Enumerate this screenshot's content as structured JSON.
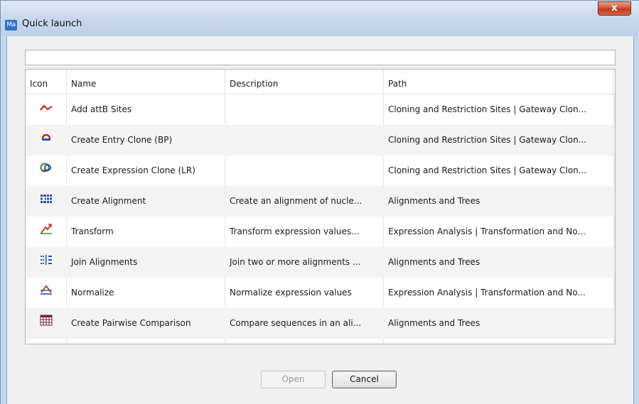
{
  "window": {
    "title": "Quick launch",
    "app_icon_text": "Ma",
    "close_glyph": "x"
  },
  "search": {
    "value": "",
    "placeholder": ""
  },
  "table": {
    "columns": [
      "Icon",
      "Name",
      "Description",
      "Path"
    ],
    "rows": [
      {
        "icon": "add-attb-sites-icon",
        "name": "Add attB Sites",
        "description": "",
        "path": "Cloning and Restriction Sites | Gateway Clon..."
      },
      {
        "icon": "create-entry-clone-icon",
        "name": "Create Entry Clone (BP)",
        "description": "",
        "path": "Cloning and Restriction Sites | Gateway Clon..."
      },
      {
        "icon": "create-expression-clone-icon",
        "name": "Create Expression Clone (LR)",
        "description": "",
        "path": "Cloning and Restriction Sites | Gateway Clon..."
      },
      {
        "icon": "create-alignment-icon",
        "name": "Create Alignment",
        "description": "Create an alignment of nucle...",
        "path": "Alignments and Trees"
      },
      {
        "icon": "transform-icon",
        "name": "Transform",
        "description": "Transform expression values...",
        "path": "Expression Analysis | Transformation and No..."
      },
      {
        "icon": "join-alignments-icon",
        "name": "Join Alignments",
        "description": "Join two or more alignments ...",
        "path": "Alignments and Trees"
      },
      {
        "icon": "normalize-icon",
        "name": "Normalize",
        "description": "Normalize expression values",
        "path": "Expression Analysis | Transformation and No..."
      },
      {
        "icon": "create-pairwise-comparison-icon",
        "name": "Create Pairwise Comparison",
        "description": "Compare sequences in an ali...",
        "path": "Alignments and Trees"
      }
    ]
  },
  "buttons": {
    "open": "Open",
    "cancel": "Cancel"
  },
  "colors": {
    "title_bar": "#c4d7ec",
    "close_button": "#c0391f",
    "row_alt": "#f3f3f3",
    "icon_red": "#c0281e",
    "icon_blue": "#2c4fb5",
    "icon_green": "#2c8a3a"
  }
}
